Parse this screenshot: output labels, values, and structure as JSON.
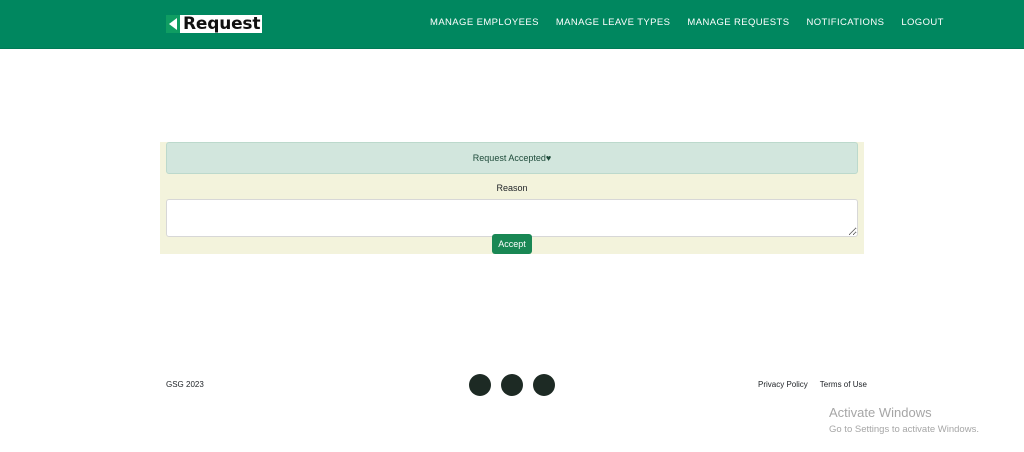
{
  "navbar": {
    "brand": "Request",
    "links": [
      "MANAGE EMPLOYEES",
      "MANAGE LEAVE TYPES",
      "MANAGE REQUESTS",
      "NOTIFICATIONS",
      "LOGOUT"
    ]
  },
  "form": {
    "alert": "Request Accepted♥",
    "reason_label": "Reason",
    "reason_value": "",
    "accept_label": "Accept"
  },
  "footer": {
    "copyright": "GSG 2023",
    "social_icons": [
      "social-icon",
      "social-icon",
      "social-icon"
    ],
    "links": [
      "Privacy Policy",
      "Terms of Use"
    ]
  },
  "watermark": {
    "title": "Activate Windows",
    "subtitle": "Go to Settings to activate Windows."
  },
  "colors": {
    "navbar": "#00875f",
    "panel": "#f3f3dc",
    "alert": "#d2e6dd",
    "button": "#198754"
  }
}
